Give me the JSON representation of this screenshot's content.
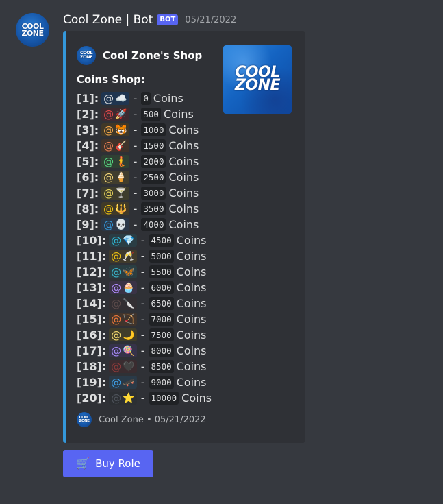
{
  "message": {
    "username": "Cool Zone | Bot",
    "bot_badge": "BOT",
    "timestamp": "05/21/2022",
    "avatar_text": "COOL\nZONE"
  },
  "embed": {
    "accent_color": "#3498db",
    "author": {
      "name": "Cool Zone's Shop",
      "logo_text": "COOL\nZONE"
    },
    "thumbnail_text": "COOL\nZONE",
    "title": "Coins Shop:",
    "items": [
      {
        "index": "[1]:",
        "at": "@",
        "emoji": "☁️",
        "role_color": "#1f3550",
        "at_color": "#dcddde",
        "price": "0",
        "unit": "Coins"
      },
      {
        "index": "[2]:",
        "at": "@",
        "emoji": "🚀",
        "role_color": "#3e2a30",
        "at_color": "#e0494a",
        "price": "500",
        "unit": "Coins"
      },
      {
        "index": "[3]:",
        "at": "@",
        "emoji": "🐯",
        "role_color": "#403828",
        "at_color": "#f0a64a",
        "price": "1000",
        "unit": "Coins"
      },
      {
        "index": "[4]:",
        "at": "@",
        "emoji": "🎸",
        "role_color": "#40332a",
        "at_color": "#e67e53",
        "price": "1500",
        "unit": "Coins"
      },
      {
        "index": "[5]:",
        "at": "@",
        "emoji": "🧜",
        "role_color": "#2f4033",
        "at_color": "#57d681",
        "price": "2000",
        "unit": "Coins"
      },
      {
        "index": "[6]:",
        "at": "@",
        "emoji": "🍦",
        "role_color": "#403d2e",
        "at_color": "#f5d77a",
        "price": "2500",
        "unit": "Coins"
      },
      {
        "index": "[7]:",
        "at": "@",
        "emoji": "🍸",
        "role_color": "#3e3d2c",
        "at_color": "#e6d35c",
        "price": "3000",
        "unit": "Coins"
      },
      {
        "index": "[8]:",
        "at": "@",
        "emoji": "🔱",
        "role_color": "#403a28",
        "at_color": "#f1c40f",
        "price": "3500",
        "unit": "Coins"
      },
      {
        "index": "[9]:",
        "at": "@",
        "emoji": "💀",
        "role_color": "#2a3747",
        "at_color": "#3498db",
        "price": "4000",
        "unit": "Coins"
      },
      {
        "index": "[10]:",
        "at": "@",
        "emoji": "💎",
        "role_color": "#2a3d44",
        "at_color": "#2fb8d6",
        "price": "4500",
        "unit": "Coins"
      },
      {
        "index": "[11]:",
        "at": "@",
        "emoji": "🥂",
        "role_color": "#403b2c",
        "at_color": "#f1c40f",
        "price": "5000",
        "unit": "Coins"
      },
      {
        "index": "[12]:",
        "at": "@",
        "emoji": "🦋",
        "role_color": "#2a3e42",
        "at_color": "#3bb3c9",
        "price": "5500",
        "unit": "Coins"
      },
      {
        "index": "[13]:",
        "at": "@",
        "emoji": "🧁",
        "role_color": "#3a3346",
        "at_color": "#b18cff",
        "price": "6000",
        "unit": "Coins"
      },
      {
        "index": "[14]:",
        "at": "@",
        "emoji": "🔪",
        "role_color": "#332f33",
        "at_color": "#5b4a4a",
        "price": "6500",
        "unit": "Coins"
      },
      {
        "index": "[15]:",
        "at": "@",
        "emoji": "🏹",
        "role_color": "#40342c",
        "at_color": "#f07a3a",
        "price": "7000",
        "unit": "Coins"
      },
      {
        "index": "[16]:",
        "at": "@",
        "emoji": "🌙",
        "role_color": "#403d2a",
        "at_color": "#f7dc6f",
        "price": "7500",
        "unit": "Coins"
      },
      {
        "index": "[17]:",
        "at": "@",
        "emoji": "🍭",
        "role_color": "#36334a",
        "at_color": "#a78bfa",
        "price": "8000",
        "unit": "Coins"
      },
      {
        "index": "[18]:",
        "at": "@",
        "emoji": "🖤",
        "role_color": "#3a2c30",
        "at_color": "#8b3a3a",
        "price": "8500",
        "unit": "Coins"
      },
      {
        "index": "[19]:",
        "at": "@",
        "emoji": "🛹",
        "role_color": "#2a3a48",
        "at_color": "#3ea0e8",
        "price": "9000",
        "unit": "Coins"
      },
      {
        "index": "[20]:",
        "at": "@",
        "emoji": "⭐",
        "role_color": "#2c2f33",
        "at_color": "#4f545c",
        "price": "10000",
        "unit": "Coins"
      }
    ],
    "footer": {
      "text": "Cool Zone • 05/21/2022",
      "logo_text": "COOL\nZONE"
    }
  },
  "button": {
    "icon": "🛒",
    "label": "Buy Role",
    "color": "#5865f2"
  }
}
